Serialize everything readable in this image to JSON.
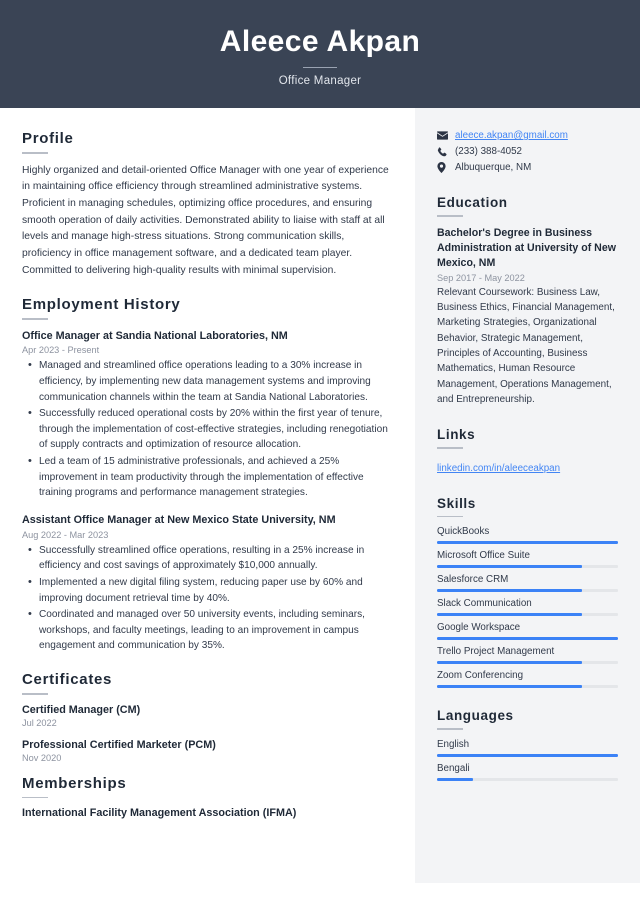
{
  "header": {
    "name": "Aleece Akpan",
    "title": "Office Manager"
  },
  "colors": {
    "header_bg": "#3a4455",
    "sidebar_bg": "#f3f4f6",
    "accent": "#3b82f6",
    "link": "#4285f4",
    "muted_text": "#8d93a0",
    "bar_track": "#e4e6e9"
  },
  "main": {
    "profile": {
      "heading": "Profile",
      "text": "Highly organized and detail-oriented Office Manager with one year of experience in maintaining office efficiency through streamlined administrative systems. Proficient in managing schedules, optimizing office procedures, and ensuring smooth operation of daily activities. Demonstrated ability to liaise with staff at all levels and manage high-stress situations. Strong communication skills, proficiency in office management software, and a dedicated team player. Committed to delivering high-quality results with minimal supervision."
    },
    "employment": {
      "heading": "Employment History",
      "jobs": [
        {
          "title": "Office Manager at Sandia National Laboratories, NM",
          "date": "Apr 2023 - Present",
          "bullets": [
            "Managed and streamlined office operations leading to a 30% increase in efficiency, by implementing new data management systems and improving communication channels within the team at Sandia National Laboratories.",
            "Successfully reduced operational costs by 20% within the first year of tenure, through the implementation of cost-effective strategies, including renegotiation of supply contracts and optimization of resource allocation.",
            "Led a team of 15 administrative professionals, and achieved a 25% improvement in team productivity through the implementation of effective training programs and performance management strategies."
          ]
        },
        {
          "title": "Assistant Office Manager at New Mexico State University, NM",
          "date": "Aug 2022 - Mar 2023",
          "bullets": [
            "Successfully streamlined office operations, resulting in a 25% increase in efficiency and cost savings of approximately $10,000 annually.",
            "Implemented a new digital filing system, reducing paper use by 60% and improving document retrieval time by 40%.",
            "Coordinated and managed over 50 university events, including seminars, workshops, and faculty meetings, leading to an improvement in campus engagement and communication by 35%."
          ]
        }
      ]
    },
    "certificates": {
      "heading": "Certificates",
      "items": [
        {
          "name": "Certified Manager (CM)",
          "date": "Jul 2022"
        },
        {
          "name": "Professional Certified Marketer (PCM)",
          "date": "Nov 2020"
        }
      ]
    },
    "memberships": {
      "heading": "Memberships",
      "items": [
        {
          "name": "International Facility Management Association (IFMA)"
        }
      ]
    }
  },
  "sidebar": {
    "contact": [
      {
        "icon": "envelope-icon",
        "value": "aleece.akpan@gmail.com",
        "is_link": true
      },
      {
        "icon": "phone-icon",
        "value": "(233) 388-4052",
        "is_link": false
      },
      {
        "icon": "location-pin-icon",
        "value": "Albuquerque, NM",
        "is_link": false
      }
    ],
    "education": {
      "heading": "Education",
      "items": [
        {
          "title": "Bachelor's Degree in Business Administration at University of New Mexico, NM",
          "date": "Sep 2017 - May 2022",
          "description": "Relevant Coursework: Business Law, Business Ethics, Financial Management, Marketing Strategies, Organizational Behavior, Strategic Management, Principles of Accounting, Business Mathematics, Human Resource Management, Operations Management, and Entrepreneurship."
        }
      ]
    },
    "links": {
      "heading": "Links",
      "items": [
        {
          "label": "linkedin.com/in/aleeceakpan"
        }
      ]
    },
    "skills": {
      "heading": "Skills",
      "items": [
        {
          "label": "QuickBooks",
          "level": 100
        },
        {
          "label": "Microsoft Office Suite",
          "level": 80
        },
        {
          "label": "Salesforce CRM",
          "level": 80
        },
        {
          "label": "Slack Communication",
          "level": 80
        },
        {
          "label": "Google Workspace",
          "level": 100
        },
        {
          "label": "Trello Project Management",
          "level": 80
        },
        {
          "label": "Zoom Conferencing",
          "level": 80
        }
      ]
    },
    "languages": {
      "heading": "Languages",
      "items": [
        {
          "label": "English",
          "level": 100
        },
        {
          "label": "Bengali",
          "level": 20
        }
      ]
    }
  }
}
